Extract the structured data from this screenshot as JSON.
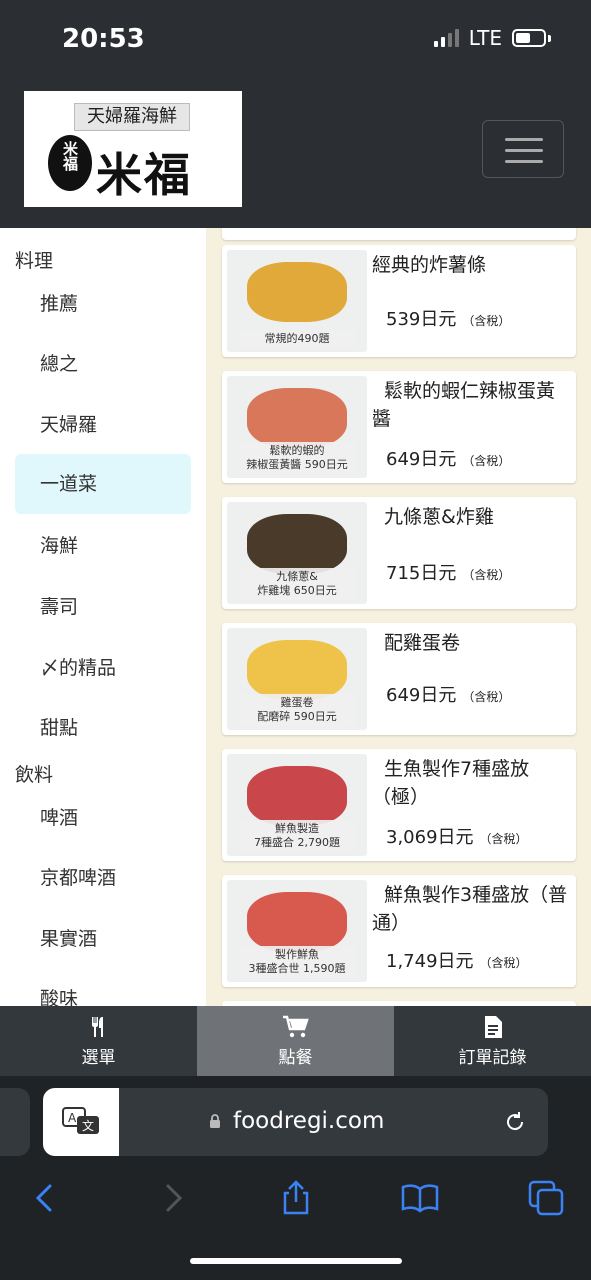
{
  "status": {
    "time": "20:53",
    "network": "LTE"
  },
  "header": {
    "logo_tagline": "天婦羅海鮮",
    "logo_seal": "米福",
    "logo_name": "米福"
  },
  "sidebar": {
    "categories": [
      {
        "label": "料理"
      },
      {
        "label": "飲料"
      }
    ],
    "items": [
      {
        "label": "推薦"
      },
      {
        "label": "總之"
      },
      {
        "label": "天婦羅"
      },
      {
        "label": "一道菜",
        "active": true
      },
      {
        "label": "海鮮"
      },
      {
        "label": "壽司"
      },
      {
        "label": "〆的精品"
      },
      {
        "label": "甜點"
      },
      {
        "label": "啤酒"
      },
      {
        "label": "京都啤酒"
      },
      {
        "label": "果實酒"
      },
      {
        "label": "酸味"
      }
    ]
  },
  "menu_items": [
    {
      "name": "經典的炸薯條",
      "price": "539日元",
      "tax": "（含稅）",
      "caption": "常規的490題"
    },
    {
      "name": "鬆軟的蝦仁辣椒蛋黃醬",
      "price": "649日元",
      "tax": "（含稅）",
      "caption": "鬆軟的蝦的\n辣椒蛋黃醬 590日元"
    },
    {
      "name": "九條蔥&炸雞",
      "price": "715日元",
      "tax": "（含稅）",
      "caption": "九條蔥&\n炸雞塊 650日元"
    },
    {
      "name": "配雞蛋卷",
      "price": "649日元",
      "tax": "（含稅）",
      "caption": "雞蛋卷\n配磨碎 590日元"
    },
    {
      "name": "生魚製作7種盛放（極）",
      "price": "3,069日元",
      "tax": "（含稅）",
      "caption": "鮮魚製造\n7種盛合 2,790題"
    },
    {
      "name": "鮮魚製作3種盛放（普通）",
      "price": "1,749日元",
      "tax": "（含稅）",
      "caption": "製作鮮魚\n3種盛合世 1,590題"
    }
  ],
  "tabbar": {
    "tabs": [
      {
        "label": "選單",
        "icon": "utensils-icon"
      },
      {
        "label": "點餐",
        "icon": "cart-icon",
        "active": true
      },
      {
        "label": "訂單記錄",
        "icon": "document-icon"
      }
    ]
  },
  "browser": {
    "url": "foodregi.com"
  }
}
